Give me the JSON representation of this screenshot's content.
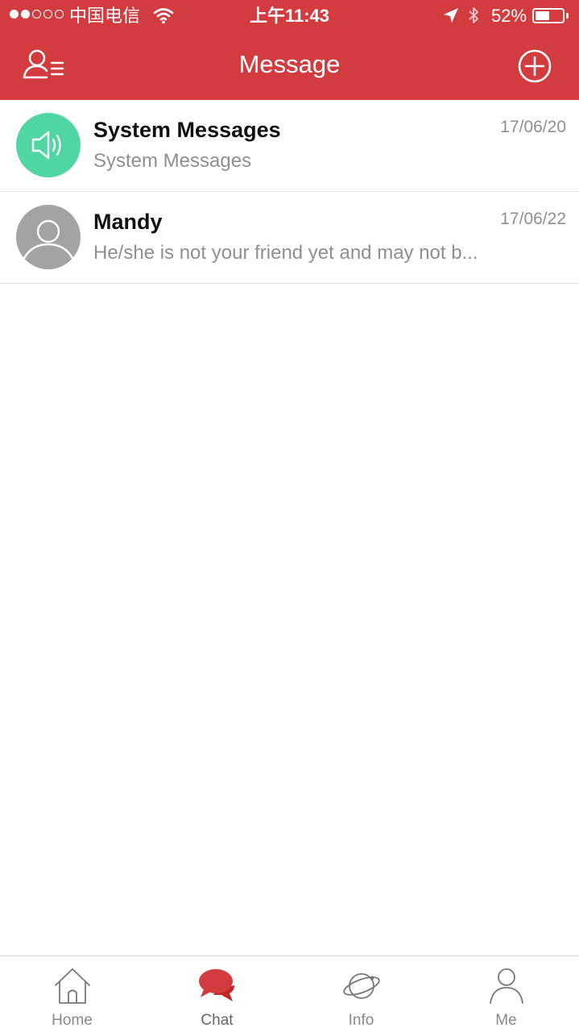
{
  "status_bar": {
    "carrier": "中国电信",
    "time": "上午11:43",
    "battery_percent_text": "52%",
    "battery_level": 0.52,
    "signal_bars_filled": 2,
    "signal_bars_total": 5
  },
  "header": {
    "title": "Message",
    "background_color": "#d33c3f",
    "left_icon": "contacts-list-icon",
    "right_icon": "add-circle-icon"
  },
  "conversations": [
    {
      "name": "System Messages",
      "preview": "System Messages",
      "date": "17/06/20",
      "avatar_icon": "speaker-icon",
      "avatar_color": "#4fd6a3"
    },
    {
      "name": "Mandy",
      "preview": "He/she is not your friend yet and may not b...",
      "date": "17/06/22",
      "avatar_icon": "default-user-icon",
      "avatar_color": "#a3a3a3"
    }
  ],
  "tab_bar": {
    "active_color": "#d33c3f",
    "tabs": [
      {
        "label": "Home",
        "icon": "home-icon"
      },
      {
        "label": "Chat",
        "icon": "chat-bubbles-icon",
        "active": true
      },
      {
        "label": "Info",
        "icon": "planet-icon"
      },
      {
        "label": "Me",
        "icon": "person-icon"
      }
    ]
  }
}
